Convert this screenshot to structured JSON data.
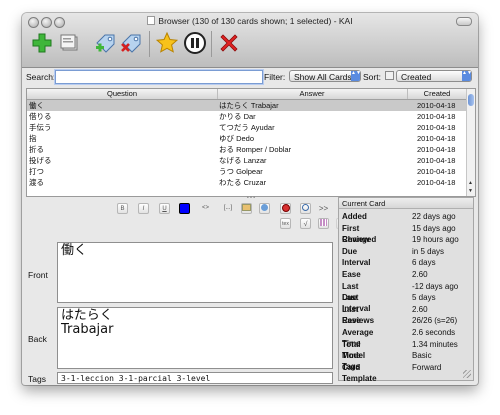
{
  "window": {
    "title": "Browser (130 of 130 cards shown; 1 selected) - KAI"
  },
  "toolbar": {
    "buttons": [
      {
        "name": "add-card-button",
        "icon": "green-plus-icon"
      },
      {
        "name": "cards-button",
        "icon": "card-stack-icon"
      },
      {
        "name": "add-tags-button",
        "icon": "add-tags-icon"
      },
      {
        "name": "delete-tags-button",
        "icon": "delete-tags-icon"
      },
      {
        "name": "mark-button",
        "icon": "star-icon"
      },
      {
        "name": "suspend-button",
        "icon": "pause-icon"
      },
      {
        "name": "delete-button",
        "icon": "red-x-icon"
      }
    ]
  },
  "search": {
    "label": "Search:",
    "value": "",
    "filter_label": "Filter:",
    "filter_value": "Show All Cards",
    "sort_label": "Sort:",
    "sort_value": "Created"
  },
  "table": {
    "headers": [
      "Question",
      "Answer",
      "Created"
    ],
    "rows": [
      {
        "question": "働く",
        "answer": "はたらく Trabajar",
        "created": "2010-04-18",
        "selected": true
      },
      {
        "question": "借りる",
        "answer": "かりる Dar",
        "created": "2010-04-18",
        "selected": false
      },
      {
        "question": "手伝う",
        "answer": "てつだう Ayudar",
        "created": "2010-04-18",
        "selected": false
      },
      {
        "question": "指",
        "answer": "ゆび Dedo",
        "created": "2010-04-18",
        "selected": false
      },
      {
        "question": "折る",
        "answer": "おる Romper / Doblar",
        "created": "2010-04-18",
        "selected": false
      },
      {
        "question": "投げる",
        "answer": "なげる Lanzar",
        "created": "2010-04-18",
        "selected": false
      },
      {
        "question": "打つ",
        "answer": "うつ Golpear",
        "created": "2010-04-18",
        "selected": false
      },
      {
        "question": "渡る",
        "answer": "わたる Cruzar",
        "created": "2010-04-18",
        "selected": false
      }
    ]
  },
  "editor": {
    "format_buttons": [
      "B",
      "I",
      "U",
      "",
      "<>",
      "[...]",
      "",
      "",
      "",
      "",
      ">>"
    ],
    "format_buttons_row2": [
      "tex",
      "√",
      "",
      ""
    ],
    "front_label": "Front",
    "front_value": "働く",
    "back_label": "Back",
    "back_value": "はたらく\nTrabajar",
    "tags_label": "Tags",
    "tags_value": "3-1-leccion 3-1-parcial 3-level",
    "text_color": "#0000ff"
  },
  "current_card": {
    "header": "Current Card",
    "stats": [
      {
        "key": "Added",
        "value": "22 days ago"
      },
      {
        "key": "First Review",
        "value": "15 days ago"
      },
      {
        "key": "Changed",
        "value": "19 hours ago"
      },
      {
        "key": "Due",
        "value": "in 5 days"
      },
      {
        "key": "Interval",
        "value": "6 days"
      },
      {
        "key": "Ease",
        "value": "2.60"
      },
      {
        "key": "Last Due",
        "value": "-12 days ago"
      },
      {
        "key": "Last Interval",
        "value": "5 days"
      },
      {
        "key": "Last Ease",
        "value": "2.60"
      },
      {
        "key": "Reviews",
        "value": "26/26 (s=26)"
      },
      {
        "key": "Average Time",
        "value": "2.6 seconds"
      },
      {
        "key": "Total Time",
        "value": "1.34 minutes"
      },
      {
        "key": "Model Tags",
        "value": "Basic"
      },
      {
        "key": "Card Template",
        "value": "Forward"
      }
    ]
  }
}
